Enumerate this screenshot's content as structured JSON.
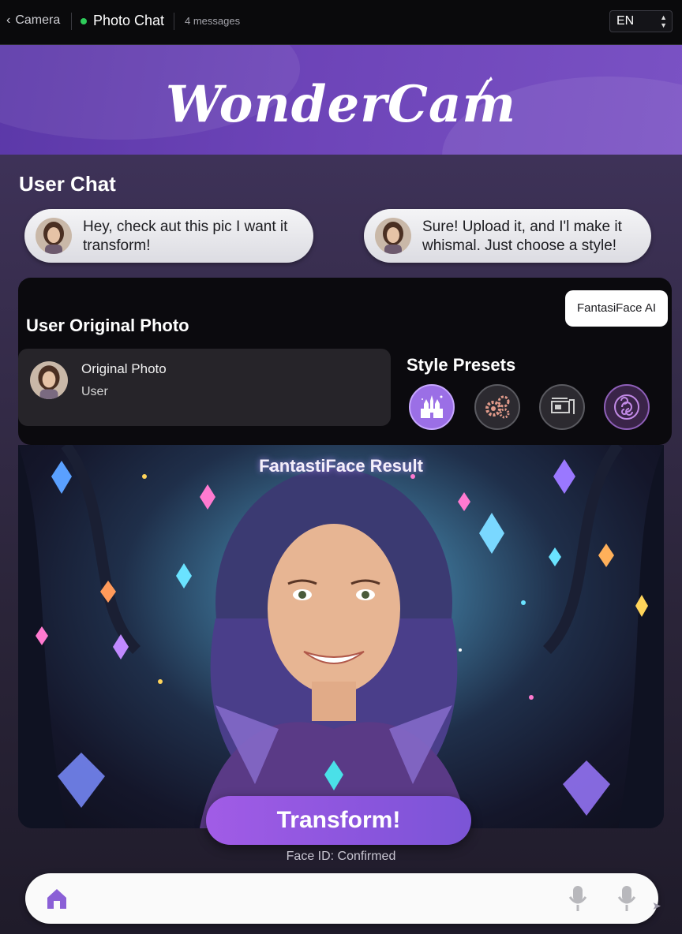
{
  "topbar": {
    "back_label": "Camera",
    "chat_title": "Photo Chat",
    "message_count": "4 messages",
    "language": "EN"
  },
  "header": {
    "logo_text": "WonderCam"
  },
  "chat": {
    "section_title": "User Chat",
    "messages": [
      {
        "text": "Hey, check aut this pic I want it transform!"
      },
      {
        "text": "Sure! Upload it, and I'l make it whismal. Just choose a style!"
      }
    ]
  },
  "panel": {
    "title": "User Original Photo",
    "ai_label": "FantasiFace AI",
    "original_card": {
      "title": "Original Photo",
      "subtitle": "User"
    },
    "presets_title": "Style Presets",
    "presets": [
      {
        "icon": "castle-icon"
      },
      {
        "icon": "gears-icon"
      },
      {
        "icon": "machine-icon"
      },
      {
        "icon": "swirl-icon"
      }
    ]
  },
  "result": {
    "title": "FantastiFace Result"
  },
  "actions": {
    "transform_label": "Transform!",
    "face_id_status": "Face ID: Confirmed"
  },
  "colors": {
    "accent": "#9b6fe6",
    "banner": "#6d44b8",
    "status_online": "#2ecc5a"
  }
}
